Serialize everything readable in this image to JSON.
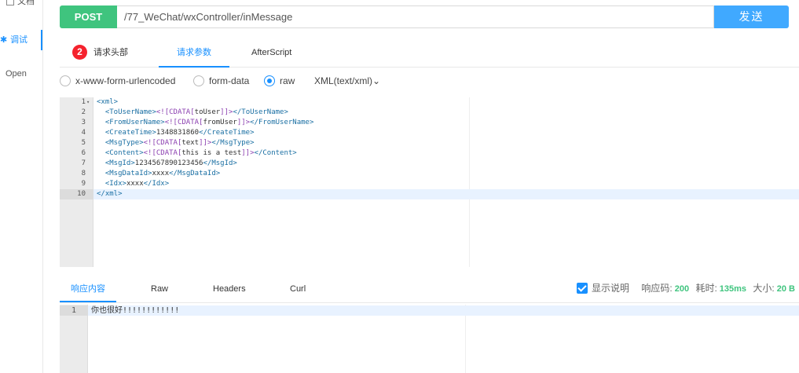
{
  "sidebar": {
    "doc_label": "文档",
    "debug_label": "调试",
    "debug_marker": "✱",
    "open_label": "Open"
  },
  "request": {
    "method": "POST",
    "url": "/77_WeChat/wxController/inMessage",
    "send_label": "发送"
  },
  "request_tabs": {
    "headers_label": "请求头部",
    "headers_count": "2",
    "params_label": "请求参数",
    "afterscript_label": "AfterScript"
  },
  "body_types": {
    "urlencoded": "x-www-form-urlencoded",
    "formdata": "form-data",
    "raw": "raw",
    "selected": "raw",
    "content_type": "XML(text/xml)"
  },
  "editor": {
    "lines": [
      {
        "num": "1",
        "indent": "",
        "parts": [
          {
            "t": "tag",
            "v": "<xml>"
          }
        ]
      },
      {
        "num": "2",
        "indent": "  ",
        "parts": [
          {
            "t": "tag",
            "v": "<ToUserName>"
          },
          {
            "t": "cdata",
            "v": "<![CDATA["
          },
          {
            "t": "text",
            "v": "toUser"
          },
          {
            "t": "cdata",
            "v": "]]>"
          },
          {
            "t": "tag",
            "v": "</ToUserName>"
          }
        ]
      },
      {
        "num": "3",
        "indent": "  ",
        "parts": [
          {
            "t": "tag",
            "v": "<FromUserName>"
          },
          {
            "t": "cdata",
            "v": "<![CDATA["
          },
          {
            "t": "text",
            "v": "fromUser"
          },
          {
            "t": "cdata",
            "v": "]]>"
          },
          {
            "t": "tag",
            "v": "</FromUserName>"
          }
        ]
      },
      {
        "num": "4",
        "indent": "  ",
        "parts": [
          {
            "t": "tag",
            "v": "<CreateTime>"
          },
          {
            "t": "text",
            "v": "1348831860"
          },
          {
            "t": "tag",
            "v": "</CreateTime>"
          }
        ]
      },
      {
        "num": "5",
        "indent": "  ",
        "parts": [
          {
            "t": "tag",
            "v": "<MsgType>"
          },
          {
            "t": "cdata",
            "v": "<![CDATA["
          },
          {
            "t": "text",
            "v": "text"
          },
          {
            "t": "cdata",
            "v": "]]>"
          },
          {
            "t": "tag",
            "v": "</MsgType>"
          }
        ]
      },
      {
        "num": "6",
        "indent": "  ",
        "parts": [
          {
            "t": "tag",
            "v": "<Content>"
          },
          {
            "t": "cdata",
            "v": "<![CDATA["
          },
          {
            "t": "text",
            "v": "this is a test"
          },
          {
            "t": "cdata",
            "v": "]]>"
          },
          {
            "t": "tag",
            "v": "</Content>"
          }
        ]
      },
      {
        "num": "7",
        "indent": "  ",
        "parts": [
          {
            "t": "tag",
            "v": "<MsgId>"
          },
          {
            "t": "text",
            "v": "1234567890123456"
          },
          {
            "t": "tag",
            "v": "</MsgId>"
          }
        ]
      },
      {
        "num": "8",
        "indent": "  ",
        "parts": [
          {
            "t": "tag",
            "v": "<MsgDataId>"
          },
          {
            "t": "text",
            "v": "xxxx"
          },
          {
            "t": "tag",
            "v": "</MsgDataId>"
          }
        ]
      },
      {
        "num": "9",
        "indent": "  ",
        "parts": [
          {
            "t": "tag",
            "v": "<Idx>"
          },
          {
            "t": "text",
            "v": "xxxx"
          },
          {
            "t": "tag",
            "v": "</Idx>"
          }
        ]
      },
      {
        "num": "10",
        "indent": "",
        "parts": [
          {
            "t": "tag",
            "v": "</xml>"
          }
        ]
      }
    ],
    "active_line": 10,
    "fold_marker": "▾"
  },
  "response_tabs": {
    "content_label": "响应内容",
    "raw_label": "Raw",
    "headers_label": "Headers",
    "curl_label": "Curl"
  },
  "response_info": {
    "show_desc_label": "显示说明",
    "status_label": "响应码:",
    "status_value": "200",
    "time_label": "耗时:",
    "time_value": "135ms",
    "size_label": "大小:",
    "size_value": "20 B"
  },
  "response": {
    "line_num": "1",
    "text": "你也很好!!!!!!!!!!!!"
  },
  "colors": {
    "post": "#3fc47e",
    "send": "#40a9ff",
    "accent": "#1890ff",
    "badge": "#f5222d"
  }
}
